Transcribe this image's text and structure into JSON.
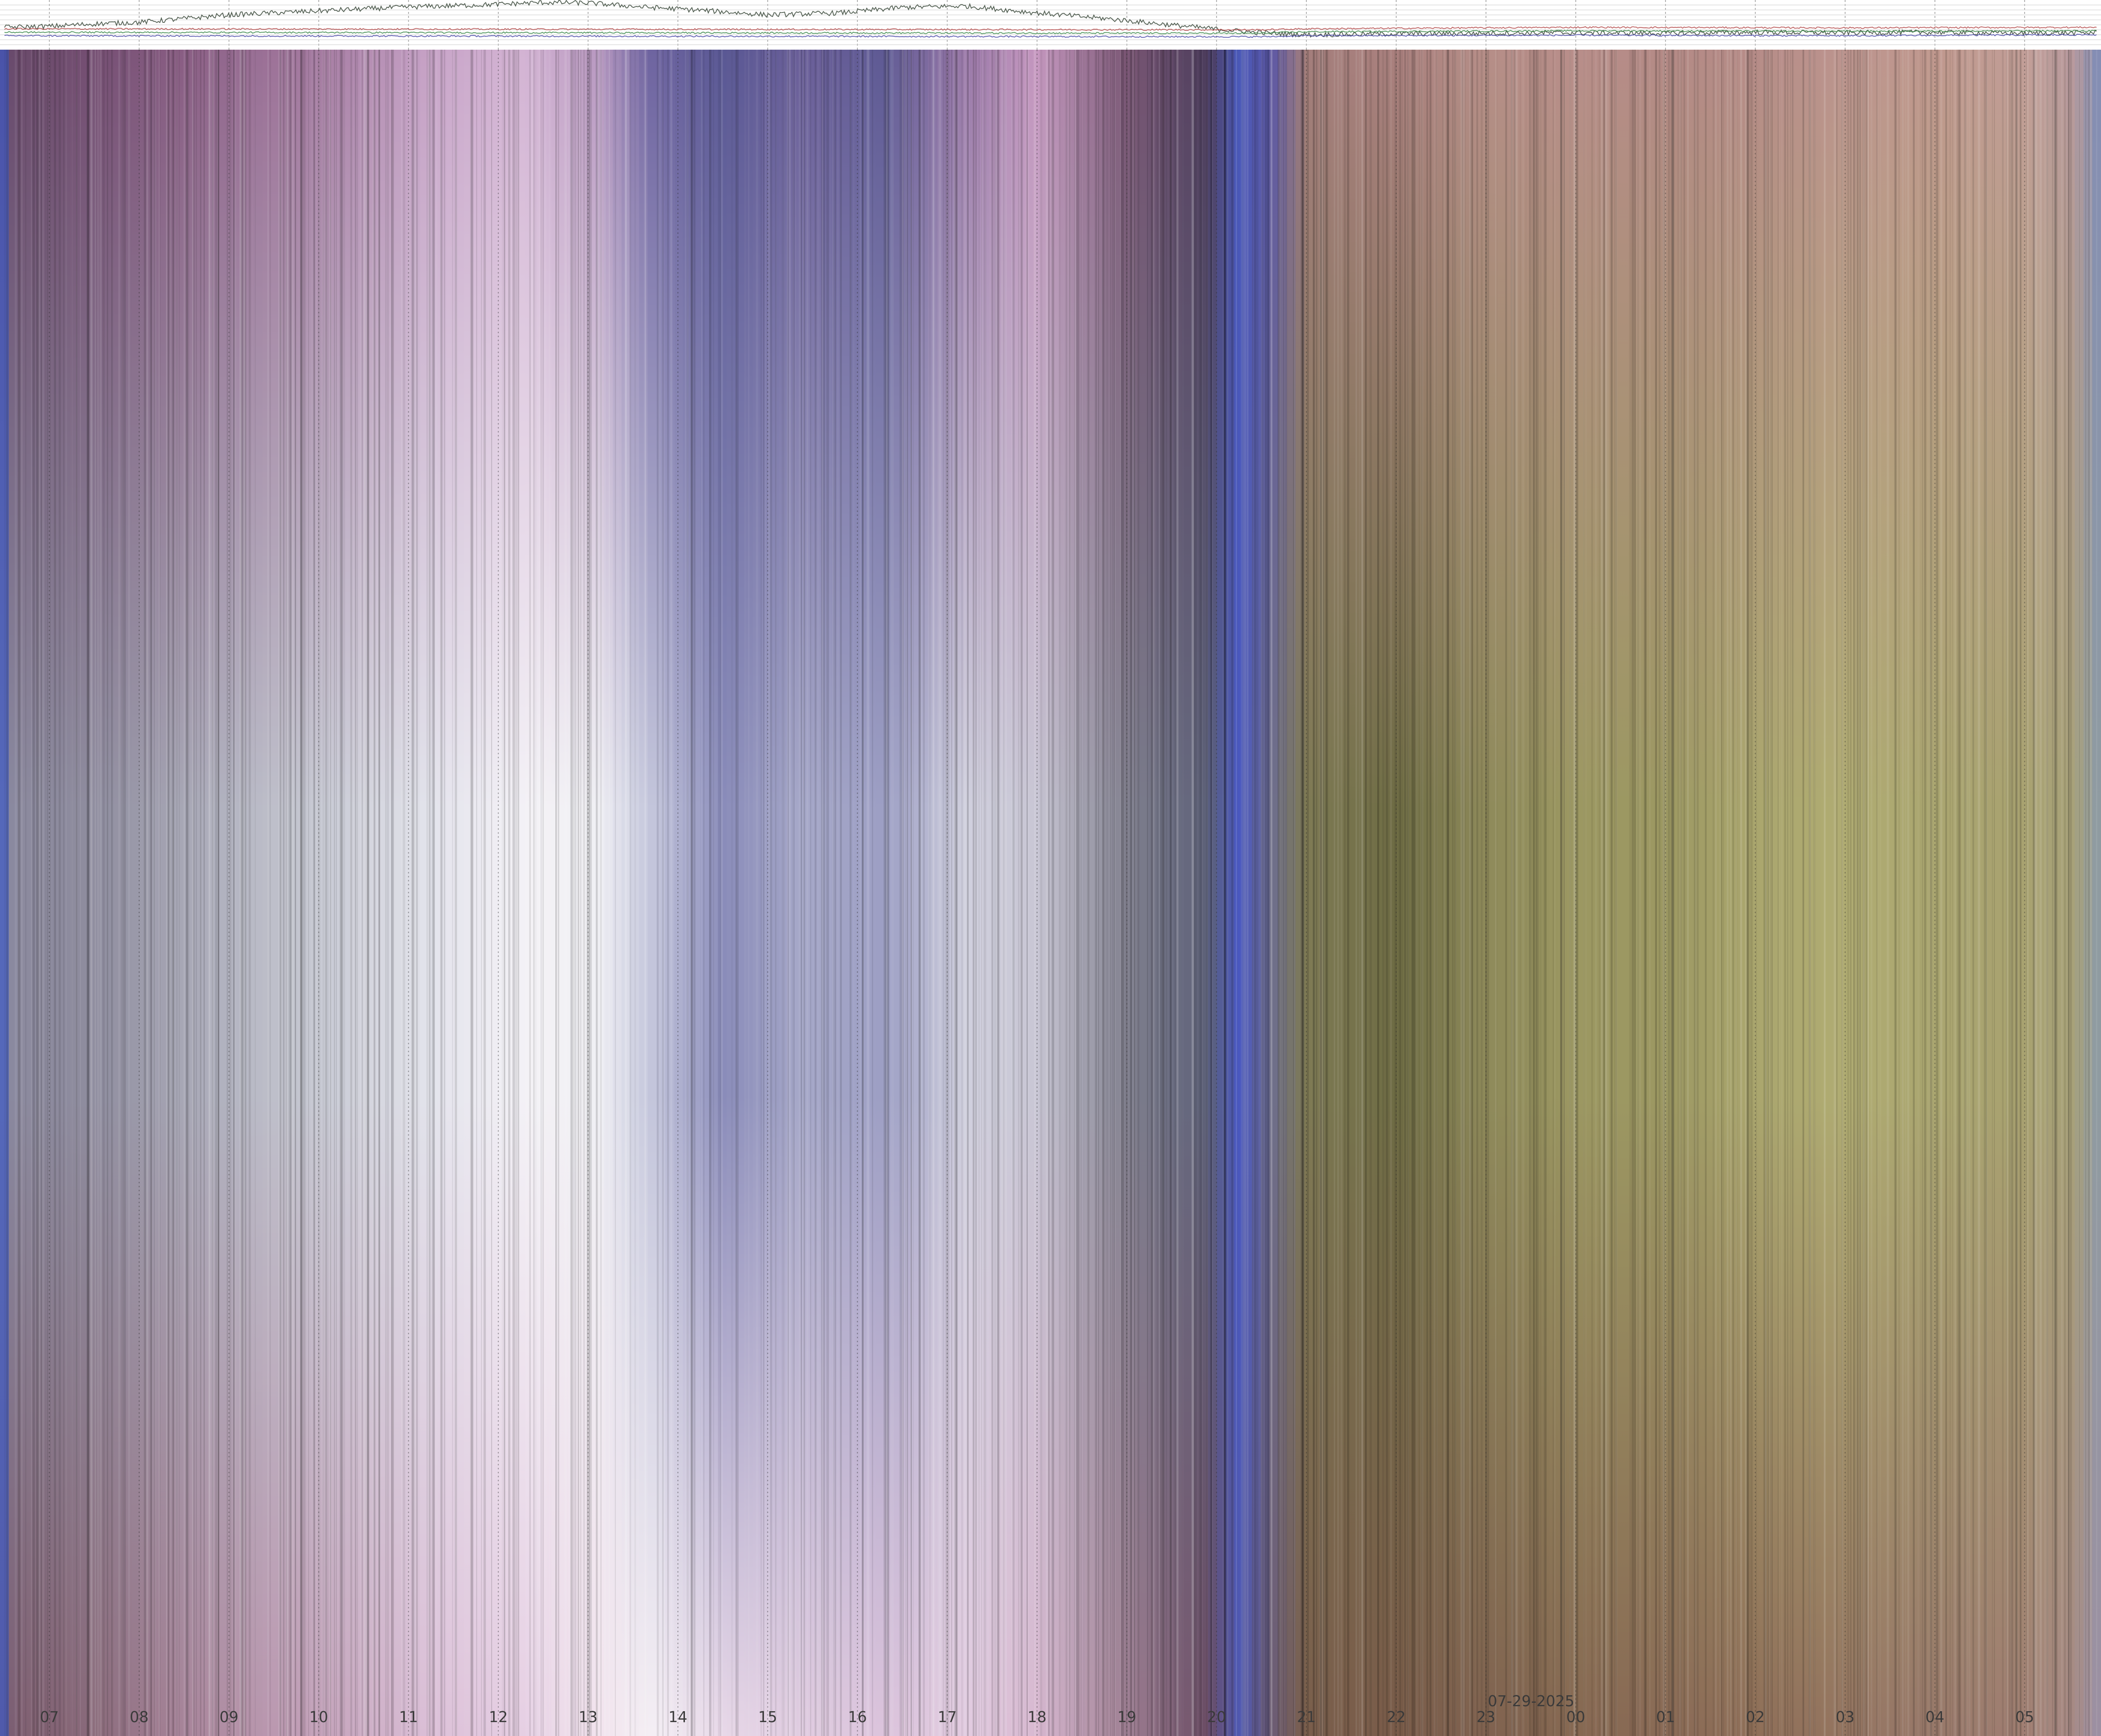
{
  "chart_data": {
    "type": "heatmap",
    "title": "",
    "xlabel": "",
    "ylabel": "",
    "date_label": "07-29-2025",
    "date_label_anchor_tick": "00",
    "x_ticks": [
      "07",
      "08",
      "09",
      "10",
      "11",
      "12",
      "13",
      "14",
      "15",
      "16",
      "17",
      "18",
      "19",
      "20",
      "21",
      "22",
      "23",
      "00",
      "01",
      "02",
      "03",
      "04",
      "05"
    ],
    "x_range_hours": [
      6.45,
      29.85
    ],
    "grid": true,
    "colors": {
      "day_magenta": "#7a5a7a",
      "day_white": "#eeeaf2",
      "day_blue": "#5d5f96",
      "twilight_blue": "#4a5ac8",
      "night_rose": "#b48a86",
      "night_olive": "#a8a46a",
      "night_brown": "#7a5e4c",
      "grid": "#2a2a2a"
    },
    "color_profile": [
      {
        "h": 6.45,
        "top": "#3a58c8",
        "mid": "#3a58c8",
        "bot": "#3a58c8"
      },
      {
        "h": 6.6,
        "top": "#6a4a6a",
        "mid": "#8c8a9e",
        "bot": "#7e5e70"
      },
      {
        "h": 7.5,
        "top": "#744e72",
        "mid": "#8e8c9e",
        "bot": "#8a6a7a"
      },
      {
        "h": 8.5,
        "top": "#8a5e84",
        "mid": "#a8a8b6",
        "bot": "#a8849a"
      },
      {
        "h": 10.0,
        "top": "#a67ca2",
        "mid": "#c8cad4",
        "bot": "#c4a2ba"
      },
      {
        "h": 11.3,
        "top": "#c8a4c8",
        "mid": "#e4e4ec",
        "bot": "#dcc0d8"
      },
      {
        "h": 12.3,
        "top": "#d4b4d4",
        "mid": "#f4f2f6",
        "bot": "#e6d0e4"
      },
      {
        "h": 13.1,
        "top": "#b898c0",
        "mid": "#f0f0f4",
        "bot": "#f2e4ee"
      },
      {
        "h": 13.7,
        "top": "#6e64a0",
        "mid": "#c4c6dc",
        "bot": "#f4eef4"
      },
      {
        "h": 14.5,
        "top": "#5a5894",
        "mid": "#8a8cba",
        "bot": "#e8d8e8"
      },
      {
        "h": 15.4,
        "top": "#6a5e98",
        "mid": "#a6a8c8",
        "bot": "#e0cce0"
      },
      {
        "h": 16.3,
        "top": "#5e5a94",
        "mid": "#9c9ec4",
        "bot": "#dcc4dc"
      },
      {
        "h": 17.2,
        "top": "#9a78a8",
        "mid": "#d0d0de",
        "bot": "#e2cce0"
      },
      {
        "h": 18.0,
        "top": "#c698c0",
        "mid": "#c8c6d4",
        "bot": "#d8b8d0"
      },
      {
        "h": 19.0,
        "top": "#7a5674",
        "mid": "#80808e",
        "bot": "#9e7e92"
      },
      {
        "h": 19.9,
        "top": "#4c3c5c",
        "mid": "#5c6078",
        "bot": "#6a4c64"
      },
      {
        "h": 20.25,
        "top": "#4a58b8",
        "mid": "#4a58c0",
        "bot": "#5058b0"
      },
      {
        "h": 20.6,
        "top": "#5c58a6",
        "mid": "#6e6e8e",
        "bot": "#6c5c76"
      },
      {
        "h": 21.0,
        "top": "#a47e7c",
        "mid": "#7e7a54",
        "bot": "#7a5e4c"
      },
      {
        "h": 22.0,
        "top": "#aa807e",
        "mid": "#6e6c44",
        "bot": "#7a5c4a"
      },
      {
        "h": 23.0,
        "top": "#b68e88",
        "mid": "#8e8a5a",
        "bot": "#806250"
      },
      {
        "h": 24.0,
        "top": "#b88e8a",
        "mid": "#9c9862",
        "bot": "#866852"
      },
      {
        "h": 25.0,
        "top": "#b48a86",
        "mid": "#9c9862",
        "bot": "#8a6a56"
      },
      {
        "h": 26.0,
        "top": "#b68c88",
        "mid": "#aaa66e",
        "bot": "#8e6e58"
      },
      {
        "h": 27.0,
        "top": "#bc948e",
        "mid": "#b0ac72",
        "bot": "#947460"
      },
      {
        "h": 28.0,
        "top": "#c0988e",
        "mid": "#aaa670",
        "bot": "#98786a"
      },
      {
        "h": 29.0,
        "top": "#c29e98",
        "mid": "#a8a270",
        "bot": "#a07e72"
      },
      {
        "h": 29.55,
        "top": "#b89a9e",
        "mid": "#a8a27a",
        "bot": "#a88a86"
      },
      {
        "h": 29.85,
        "top": "#7a8ab8",
        "mid": "#8a9aa8",
        "bot": "#9a90a8"
      }
    ],
    "series": [
      {
        "values": [
          {
            "h": 6.5,
            "y": 0.45
          },
          {
            "h": 7.0,
            "y": 0.47
          },
          {
            "h": 7.5,
            "y": 0.52
          },
          {
            "h": 8.0,
            "y": 0.55
          },
          {
            "h": 9.0,
            "y": 0.7
          },
          {
            "h": 10.0,
            "y": 0.78
          },
          {
            "h": 11.0,
            "y": 0.86
          },
          {
            "h": 11.8,
            "y": 0.9
          },
          {
            "h": 12.5,
            "y": 0.95
          },
          {
            "h": 13.0,
            "y": 0.94
          },
          {
            "h": 13.6,
            "y": 0.86
          },
          {
            "h": 14.2,
            "y": 0.8
          },
          {
            "h": 15.0,
            "y": 0.7
          },
          {
            "h": 15.8,
            "y": 0.74
          },
          {
            "h": 16.5,
            "y": 0.85
          },
          {
            "h": 17.2,
            "y": 0.88
          },
          {
            "h": 18.0,
            "y": 0.74
          },
          {
            "h": 18.8,
            "y": 0.62
          },
          {
            "h": 19.6,
            "y": 0.48
          },
          {
            "h": 20.4,
            "y": 0.35
          },
          {
            "h": 21.0,
            "y": 0.3
          },
          {
            "h": 22.0,
            "y": 0.32
          },
          {
            "h": 23.0,
            "y": 0.33
          },
          {
            "h": 24.0,
            "y": 0.34
          },
          {
            "h": 25.0,
            "y": 0.33
          },
          {
            "h": 26.0,
            "y": 0.35
          },
          {
            "h": 27.0,
            "y": 0.34
          },
          {
            "h": 28.0,
            "y": 0.35
          },
          {
            "h": 29.0,
            "y": 0.33
          },
          {
            "h": 29.8,
            "y": 0.34
          }
        ],
        "color": "#3c4a3c",
        "noise": 0.05
      },
      {
        "values": [
          {
            "h": 6.5,
            "y": 0.42
          },
          {
            "h": 20.5,
            "y": 0.4
          },
          {
            "h": 21.0,
            "y": 0.42
          },
          {
            "h": 24.0,
            "y": 0.45
          },
          {
            "h": 27.0,
            "y": 0.44
          },
          {
            "h": 29.8,
            "y": 0.45
          }
        ],
        "color": "#b44a4a",
        "noise": 0.015
      },
      {
        "values": [
          {
            "h": 6.5,
            "y": 0.35
          },
          {
            "h": 20.5,
            "y": 0.33
          },
          {
            "h": 21.0,
            "y": 0.36
          },
          {
            "h": 24.0,
            "y": 0.38
          },
          {
            "h": 27.0,
            "y": 0.37
          },
          {
            "h": 29.8,
            "y": 0.38
          }
        ],
        "color": "#3c8a4a",
        "noise": 0.015
      },
      {
        "values": [
          {
            "h": 6.5,
            "y": 0.28
          },
          {
            "h": 20.5,
            "y": 0.26
          },
          {
            "h": 21.0,
            "y": 0.28
          },
          {
            "h": 24.0,
            "y": 0.29
          },
          {
            "h": 27.0,
            "y": 0.28
          },
          {
            "h": 29.8,
            "y": 0.3
          }
        ],
        "color": "#4a4aa8",
        "noise": 0.015
      }
    ]
  }
}
